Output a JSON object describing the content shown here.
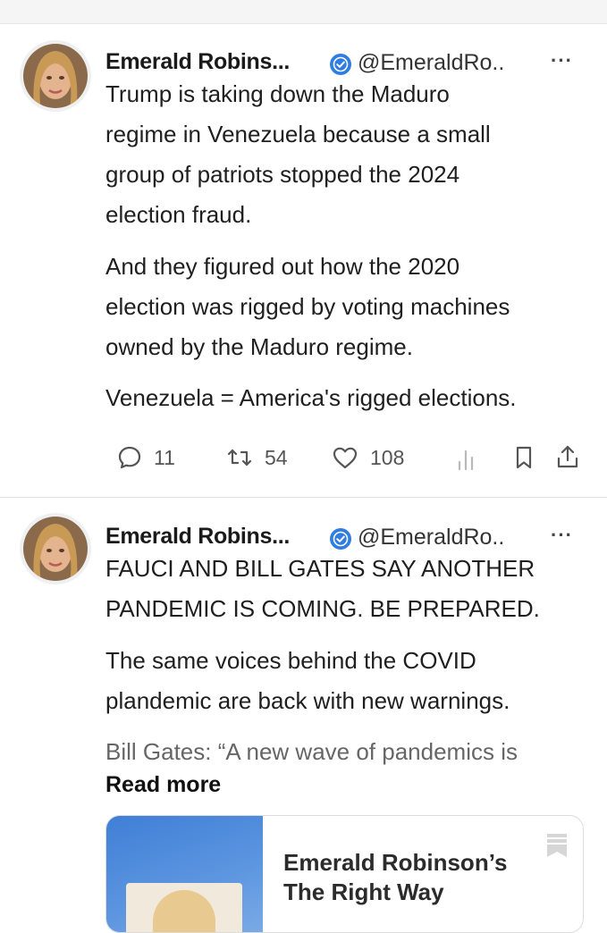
{
  "posts": [
    {
      "author_name": "Emerald Robins...",
      "handle": "@EmeraldRo..",
      "paragraphs": [
        [
          "Trump is taking down the Maduro",
          "regime in Venezuela because a small",
          "group of patriots stopped the 2024",
          "election fraud."
        ],
        [
          "And they figured out how the 2020",
          "election was rigged by voting machines",
          "owned by the Maduro regime."
        ],
        [
          "Venezuela = America's rigged elections."
        ]
      ],
      "actions": {
        "replies": "11",
        "reposts": "54",
        "likes": "108"
      }
    },
    {
      "author_name": "Emerald Robins...",
      "handle": "@EmeraldRo..",
      "paragraphs": [
        [
          "FAUCI AND BILL GATES SAY ANOTHER",
          "PANDEMIC IS COMING. BE PREPARED."
        ],
        [
          "The same voices behind the COVID",
          "plandemic are back with new warnings."
        ],
        [
          "Bill Gates: “A new wave of pandemics is"
        ]
      ],
      "read_more": "Read more",
      "card": {
        "title": "Emerald Robinson’s\nThe Right Way"
      }
    }
  ],
  "colors": {
    "verified": "#2f7de1",
    "card_thumb": "#4a88db"
  },
  "icons": [
    "verified-badge-icon",
    "more-icon",
    "reply-icon",
    "repost-icon",
    "like-icon",
    "views-icon",
    "bookmark-icon",
    "share-icon"
  ]
}
